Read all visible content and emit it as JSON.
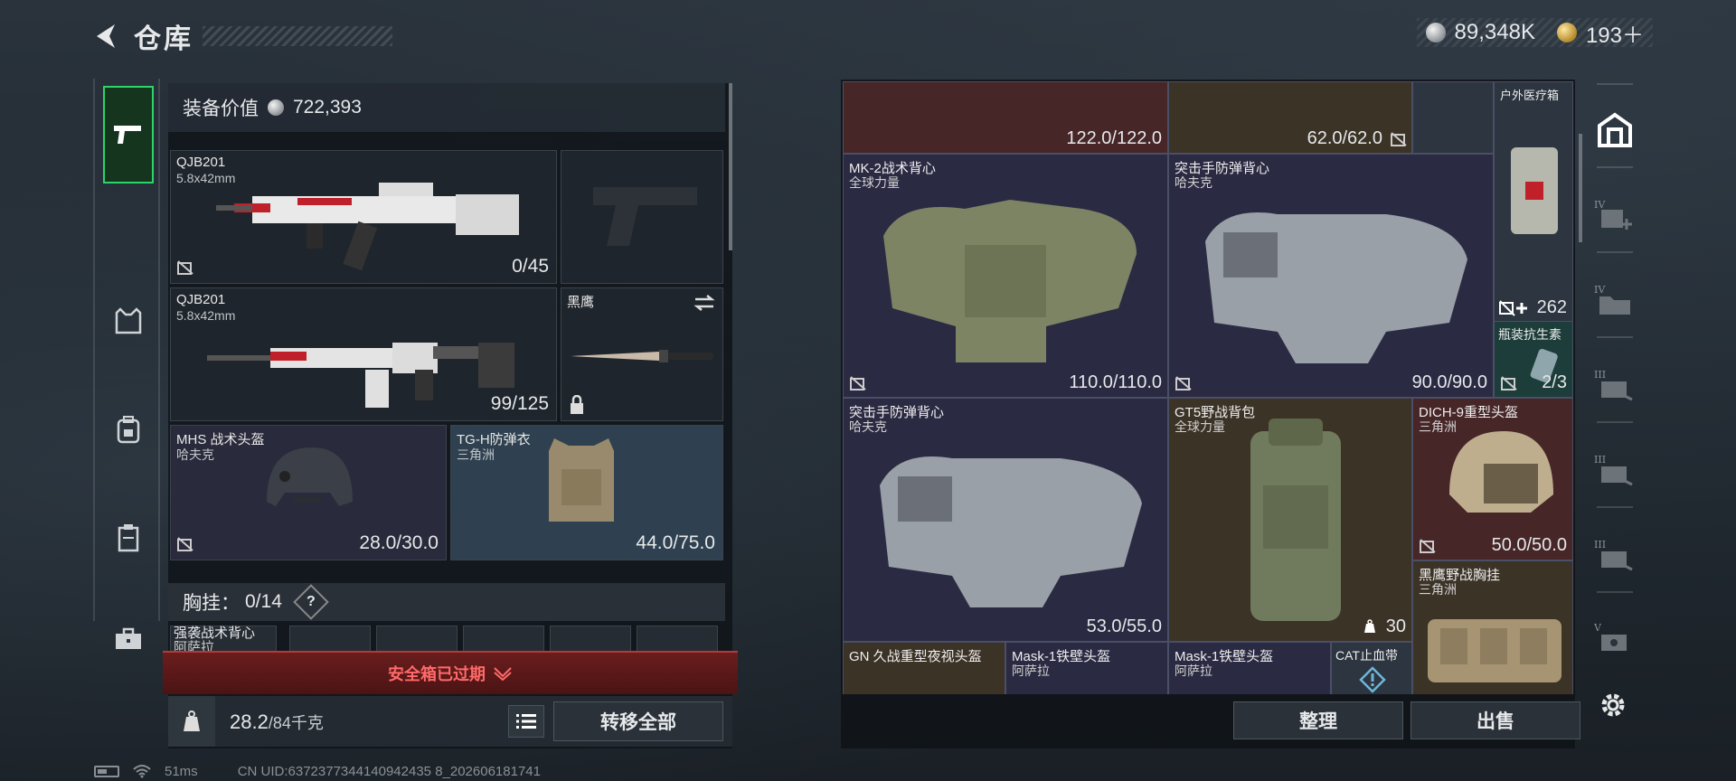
{
  "header": {
    "title": "仓库",
    "silver_amount": "89,348K",
    "gold_amount": "193＋"
  },
  "left_tabs": [
    {
      "icon": "pistol-icon",
      "active": true
    },
    {
      "icon": "vest-icon",
      "active": false
    },
    {
      "icon": "backpack-icon",
      "active": false
    },
    {
      "icon": "chest-rig-icon",
      "active": false
    },
    {
      "icon": "toolbox-icon",
      "active": false
    }
  ],
  "equipment": {
    "value_label": "装备价值",
    "value": "722,393",
    "primary_weapon": {
      "name": "QJB201",
      "caliber": "5.8x42mm",
      "ammo": "0/45"
    },
    "secondary_weapon": {
      "name": "QJB201",
      "caliber": "5.8x42mm",
      "ammo": "99/125"
    },
    "melee": {
      "name": "黑鹰"
    },
    "helmet": {
      "name": "MHS 战术头盔",
      "brand": "哈夫克",
      "durability": "28.0/30.0"
    },
    "armor": {
      "name": "TG-H防弹衣",
      "brand": "三角洲",
      "durability": "44.0/75.0"
    },
    "chest_rig": {
      "label": "胸挂：",
      "capacity": "0/14",
      "help": "?"
    },
    "chest_item": {
      "name": "强袭战术背心",
      "brand": "阿萨拉"
    }
  },
  "safe_box": {
    "expired_text": "安全箱已过期"
  },
  "bottom_left": {
    "weight_value": "28.2",
    "weight_max": "/84千克",
    "transfer_all": "转移全部"
  },
  "storage": {
    "items": [
      {
        "name": "",
        "brand": "",
        "value": "122.0/122.0"
      },
      {
        "name": "",
        "brand": "",
        "value": "62.0/62.0"
      },
      {
        "name": "户外医疗箱",
        "brand": "",
        "value": ""
      },
      {
        "name": "MK-2战术背心",
        "brand": "全球力量",
        "value": "110.0/110.0"
      },
      {
        "name": "突击手防弹背心",
        "brand": "哈夫克",
        "value": "90.0/90.0"
      },
      {
        "name": "",
        "brand": "",
        "value": "262"
      },
      {
        "name": "瓶装抗生素",
        "brand": "",
        "value": "2/3"
      },
      {
        "name": "突击手防弹背心",
        "brand": "哈夫克",
        "value": "53.0/55.0"
      },
      {
        "name": "GT5野战背包",
        "brand": "全球力量",
        "value": "30"
      },
      {
        "name": "DICH-9重型头盔",
        "brand": "三角洲",
        "value": "50.0/50.0"
      },
      {
        "name": "黑鹰野战胸挂",
        "brand": "三角洲",
        "value": ""
      },
      {
        "name": "GN 久战重型夜视头盔",
        "brand": "",
        "value": ""
      },
      {
        "name": "Mask-1铁壁头盔",
        "brand": "阿萨拉",
        "value": ""
      },
      {
        "name": "Mask-1铁壁头盔",
        "brand": "阿萨拉",
        "value": ""
      },
      {
        "name": "CAT止血带",
        "brand": "",
        "value": ""
      }
    ],
    "sort": "整理",
    "sell": "出售"
  },
  "right_tabs": [
    {
      "icon": "storage-home-icon",
      "level": ""
    },
    {
      "icon": "expand-storage-icon",
      "level": "IV"
    },
    {
      "icon": "storage-folder-icon",
      "level": "IV"
    },
    {
      "icon": "storage-hand-icon",
      "level": "III"
    },
    {
      "icon": "storage-hand-icon",
      "level": "III"
    },
    {
      "icon": "storage-hand-icon",
      "level": "III"
    },
    {
      "icon": "storage-box-icon",
      "level": "V"
    }
  ],
  "status": {
    "ping": "51ms",
    "uid": "CN UID:6372377344140942435 8_202606181741"
  },
  "colors": {
    "accent": "#2bd56a",
    "warning": "#ff6a6a"
  }
}
